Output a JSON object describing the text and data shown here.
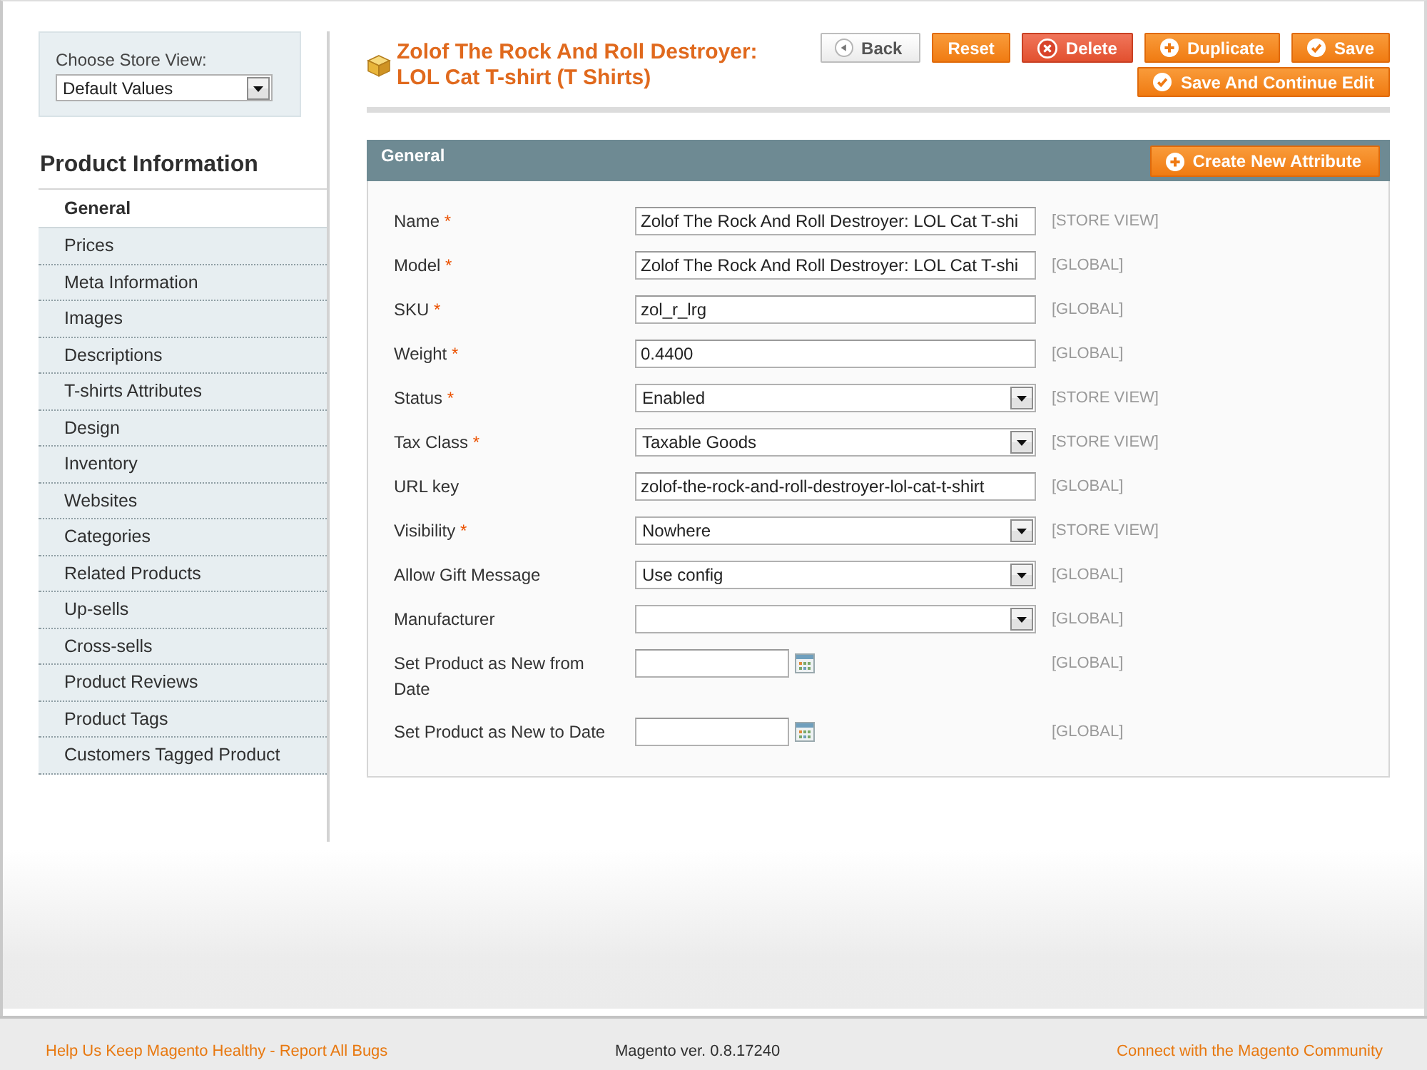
{
  "store_switcher": {
    "label": "Choose Store View:",
    "value": "Default Values"
  },
  "sidebar": {
    "title": "Product Information",
    "items": [
      {
        "label": "General",
        "selected": true
      },
      {
        "label": "Prices",
        "selected": false
      },
      {
        "label": "Meta Information",
        "selected": false
      },
      {
        "label": "Images",
        "selected": false
      },
      {
        "label": "Descriptions",
        "selected": false
      },
      {
        "label": "T-shirts Attributes",
        "selected": false
      },
      {
        "label": "Design",
        "selected": false
      },
      {
        "label": "Inventory",
        "selected": false
      },
      {
        "label": "Websites",
        "selected": false
      },
      {
        "label": "Categories",
        "selected": false
      },
      {
        "label": "Related Products",
        "selected": false
      },
      {
        "label": "Up-sells",
        "selected": false
      },
      {
        "label": "Cross-sells",
        "selected": false
      },
      {
        "label": "Product Reviews",
        "selected": false
      },
      {
        "label": "Product Tags",
        "selected": false
      },
      {
        "label": "Customers Tagged Product",
        "selected": false
      }
    ]
  },
  "header": {
    "title": "Zolof The Rock And Roll Destroyer: LOL Cat T-shirt (T Shirts)",
    "button_rows": [
      [
        {
          "label": "Back",
          "kind": "back"
        },
        {
          "label": "Reset",
          "kind": "reset"
        },
        {
          "label": "Delete",
          "kind": "delete"
        },
        {
          "label": "Duplicate",
          "kind": "duplicate"
        },
        {
          "label": "Save",
          "kind": "save"
        }
      ],
      [
        {
          "label": "Save And Continue Edit",
          "kind": "save-continue"
        }
      ]
    ]
  },
  "section": {
    "title": "General",
    "button": {
      "label": "Create New Attribute",
      "kind": "add"
    },
    "fields": [
      {
        "kind": "text",
        "label": "Name",
        "required_mark": "*",
        "value": "Zolof The Rock And Roll Destroyer: LOL Cat T-shi",
        "scope": "[STORE VIEW]"
      },
      {
        "kind": "text",
        "label": "Model",
        "required_mark": "*",
        "value": "Zolof The Rock And Roll Destroyer: LOL Cat T-shi",
        "scope": "[GLOBAL]"
      },
      {
        "kind": "text",
        "label": "SKU",
        "required_mark": "*",
        "value": "zol_r_lrg",
        "scope": "[GLOBAL]"
      },
      {
        "kind": "text",
        "label": "Weight",
        "required_mark": "*",
        "value": "0.4400",
        "scope": "[GLOBAL]"
      },
      {
        "kind": "select",
        "label": "Status",
        "required_mark": "*",
        "value": "Enabled",
        "scope": "[STORE VIEW]"
      },
      {
        "kind": "select",
        "label": "Tax Class",
        "required_mark": "*",
        "value": "Taxable Goods",
        "scope": "[STORE VIEW]"
      },
      {
        "kind": "text",
        "label": "URL key",
        "value": "zolof-the-rock-and-roll-destroyer-lol-cat-t-shirt",
        "scope": "[GLOBAL]"
      },
      {
        "kind": "select",
        "label": "Visibility",
        "required_mark": "*",
        "value": "Nowhere",
        "scope": "[STORE VIEW]"
      },
      {
        "kind": "select",
        "label": "Allow Gift Message",
        "value": "Use config",
        "scope": "[GLOBAL]"
      },
      {
        "kind": "select",
        "label": "Manufacturer",
        "scope": "[GLOBAL]"
      },
      {
        "kind": "date",
        "label": "Set Product as New from Date",
        "scope": "[GLOBAL]"
      },
      {
        "kind": "date",
        "label": "Set Product as New to Date",
        "scope": "[GLOBAL]"
      }
    ]
  },
  "footer": {
    "report_link": "Help Us Keep Magento Healthy - Report All Bugs",
    "version": "Magento ver. 0.8.17240",
    "community_link": "Connect with the Magento Community"
  }
}
